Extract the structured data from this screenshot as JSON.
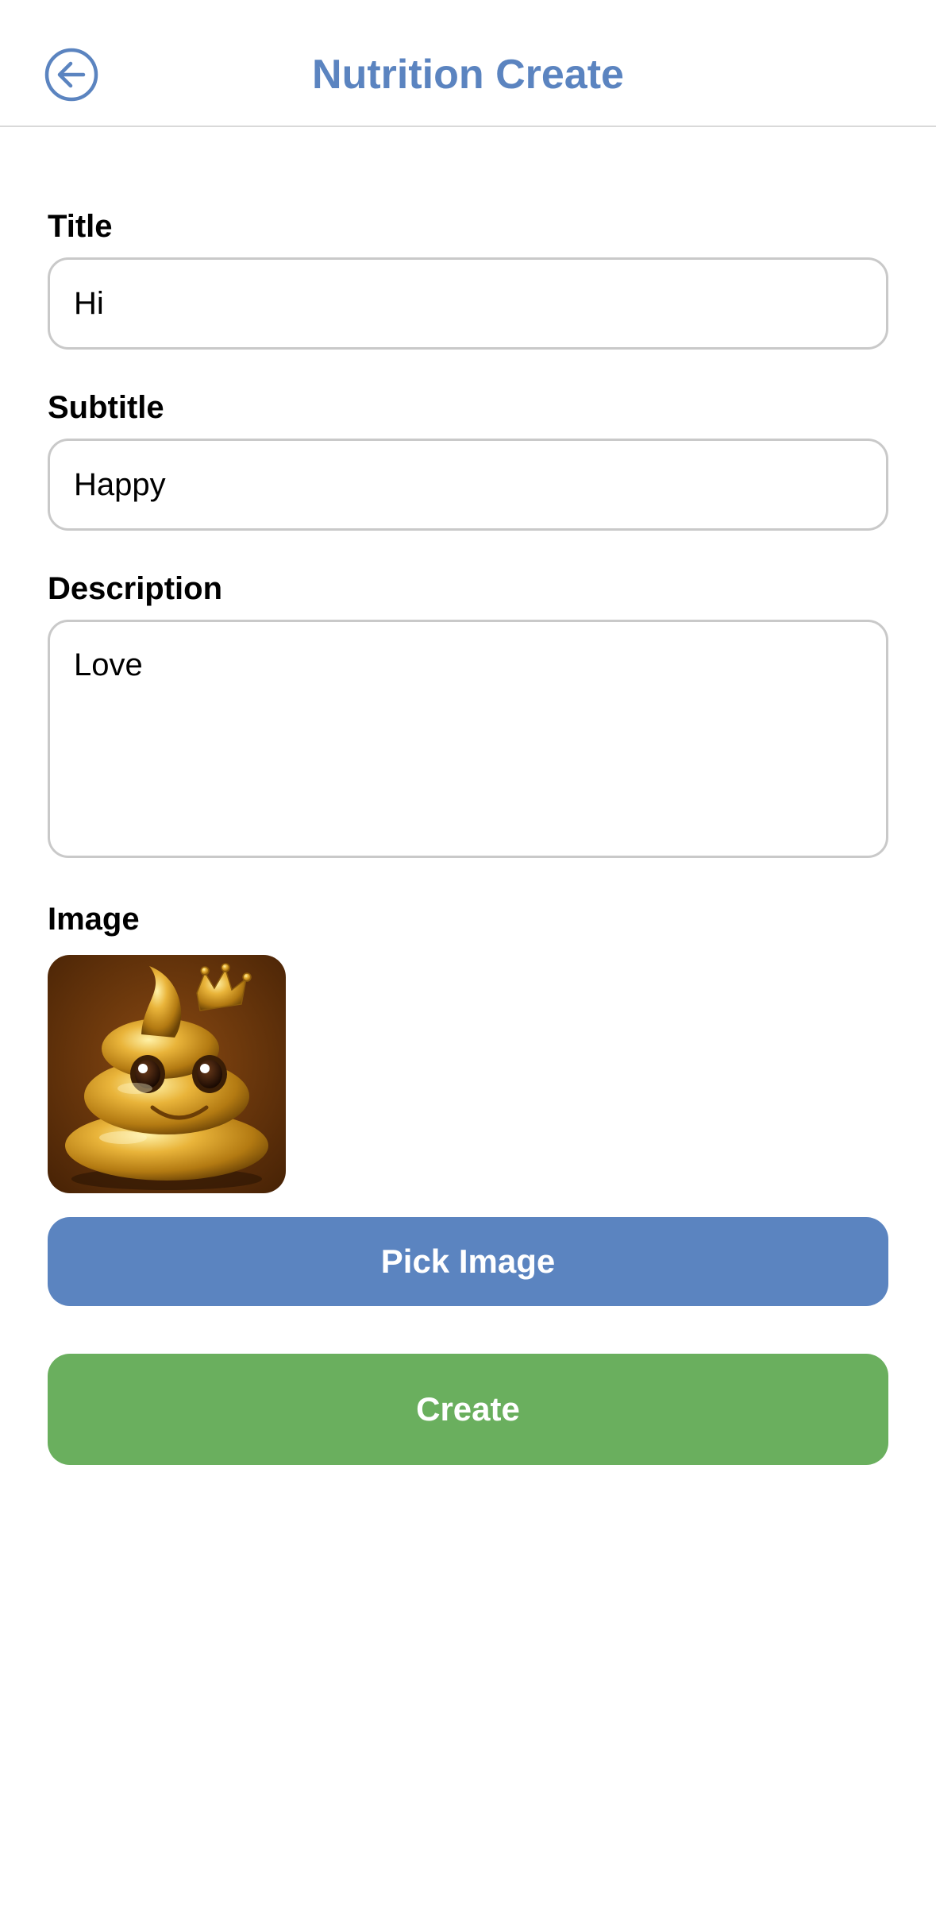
{
  "header": {
    "title": "Nutrition Create",
    "back_icon": "back-arrow-circle-icon"
  },
  "form": {
    "title_label": "Title",
    "title_value": "Hi",
    "subtitle_label": "Subtitle",
    "subtitle_value": "Happy",
    "description_label": "Description",
    "description_value": "Love",
    "image_label": "Image",
    "image_alt": "golden-crowned-poop-emoji"
  },
  "actions": {
    "pick_image_label": "Pick Image",
    "create_label": "Create"
  },
  "colors": {
    "accent_blue": "#5b84c0",
    "create_green": "#6aaf5e",
    "border_gray": "#c9c9c9"
  }
}
